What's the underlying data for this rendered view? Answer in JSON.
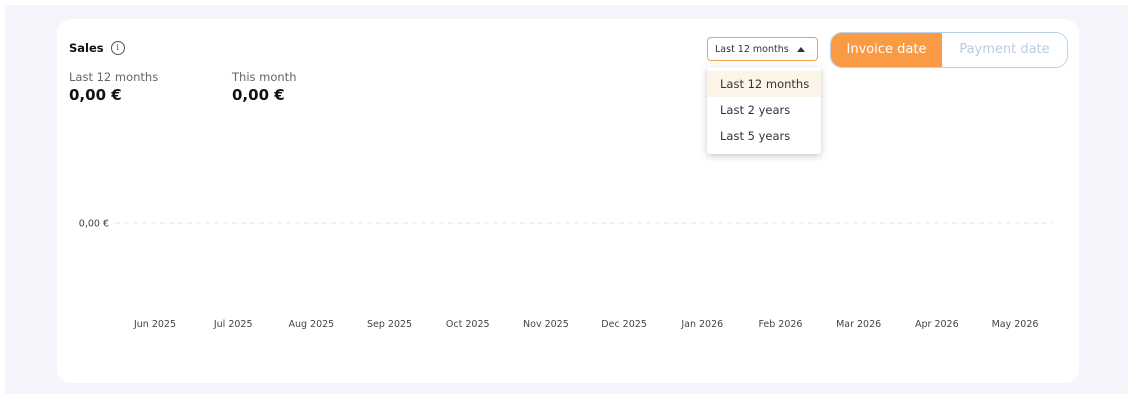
{
  "sales": {
    "title": "Sales",
    "info_icon": "info-icon",
    "stats": [
      {
        "label": "Last 12 months",
        "value": "0,00 €"
      },
      {
        "label": "This month",
        "value": "0,00 €"
      }
    ]
  },
  "period_select": {
    "selected": "Last 12 months",
    "options": [
      "Last 12 months",
      "Last 2 years",
      "Last 5 years"
    ],
    "caret_icon": "caret-up-icon"
  },
  "date_toggle": {
    "options": [
      "Invoice date",
      "Payment date"
    ],
    "active": "Invoice date"
  },
  "colors": {
    "accent": "#fa9a45",
    "select_border": "#f5a04a",
    "toggle_border": "#b9d3ec",
    "inactive_text": "#b6cde4",
    "background": "#f4f6fb"
  },
  "chart_data": {
    "type": "line",
    "categories": [
      "Jun 2025",
      "Jul 2025",
      "Aug 2025",
      "Sep 2025",
      "Oct 2025",
      "Nov 2025",
      "Dec 2025",
      "Jan 2026",
      "Feb 2026",
      "Mar 2026",
      "Apr 2026",
      "May 2026"
    ],
    "series": [
      {
        "values": [
          0,
          0,
          0,
          0,
          0,
          0,
          0,
          0,
          0,
          0,
          0,
          0
        ]
      }
    ],
    "y_ticks": [
      "0,00 €"
    ],
    "title": "",
    "xlabel": "",
    "ylabel": "",
    "grid": true
  }
}
